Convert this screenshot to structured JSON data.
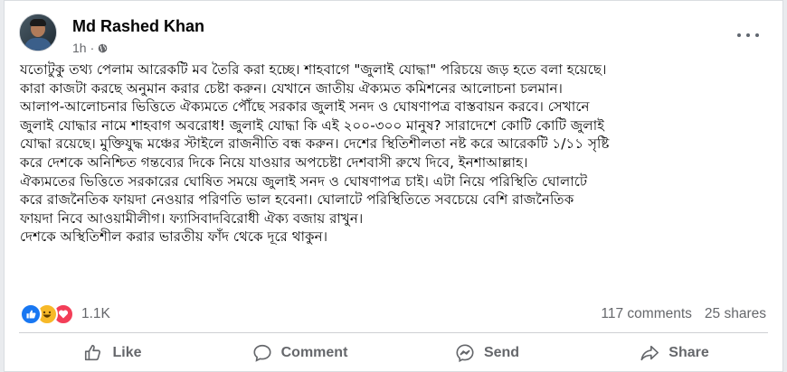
{
  "post": {
    "author": "Md Rashed Khan",
    "timestamp": "1h",
    "separator": "·",
    "audience_icon": "globe-icon",
    "paragraph_lines": [
      "যতোটুকু তথ্য পেলাম আরেকটি মব তৈরি করা হচ্ছে। শাহবাগে \"জুলাই যোদ্ধা\" পরিচয়ে জড় হতে বলা হয়েছে।",
      "কারা কাজটা করছে অনুমান করার চেষ্টা করুন। যেখানে জাতীয় ঐক্যমত কমিশনের আলোচনা চলমান।",
      "আলাপ-আলোচনার ভিত্তিতে ঐক্যমতে পৌঁছে সরকার জুলাই সনদ ও ঘোষণাপত্র বাস্তবায়ন করবে। সেখানে",
      "জুলাই যোদ্ধার নামে শাহবাগ অবরোধ! জুলাই যোদ্ধা কি এই ২০০-৩০০ মানুষ? সারাদেশে কোটি কোটি জুলাই",
      "যোদ্ধা রয়েছে। মুক্তিযুদ্ধ মঞ্চের স্টাইলে রাজনীতি বন্ধ করুন। দেশের স্থিতিশীলতা নষ্ট করে আরেকটি ১/১১ সৃষ্টি",
      "করে দেশকে অনিশ্চিত গন্তব্যের দিকে নিয়ে যাওয়ার অপচেষ্টা দেশবাসী রুখে দিবে, ইনশাআল্লাহ।",
      "ঐক্যমতের ভিত্তিতে সরকারের ঘোষিত সময়ে জুলাই সনদ ও ঘোষণাপত্র চাই। এটা নিয়ে পরিস্থিতি ঘোলাটে",
      "করে রাজনৈতিক ফায়দা নেওয়ার পরিণতি ভাল হবেনা। ঘোলাটে পরিস্থিতিতে সবচেয়ে বেশি রাজনৈতিক",
      "ফায়দা নিবে আওয়ামীলীগ। ফ্যাসিবাদবিরোধী ঐক্য বজায় রাখুন।",
      "দেশকে অস্থিতিশীল করার ভারতীয় ফাঁদ থেকে দূরে থাকুন।"
    ]
  },
  "stats": {
    "reaction_icons": [
      "like-icon",
      "haha-icon",
      "love-icon"
    ],
    "reaction_count": "1.1K",
    "comments": "117 comments",
    "shares": "25 shares"
  },
  "actions": {
    "like": "Like",
    "comment": "Comment",
    "send": "Send",
    "share": "Share"
  },
  "colors": {
    "like_blue": "#1877f2",
    "haha_yellow": "#f7b928",
    "love_red": "#f33e58",
    "secondary_text": "#65676b"
  }
}
